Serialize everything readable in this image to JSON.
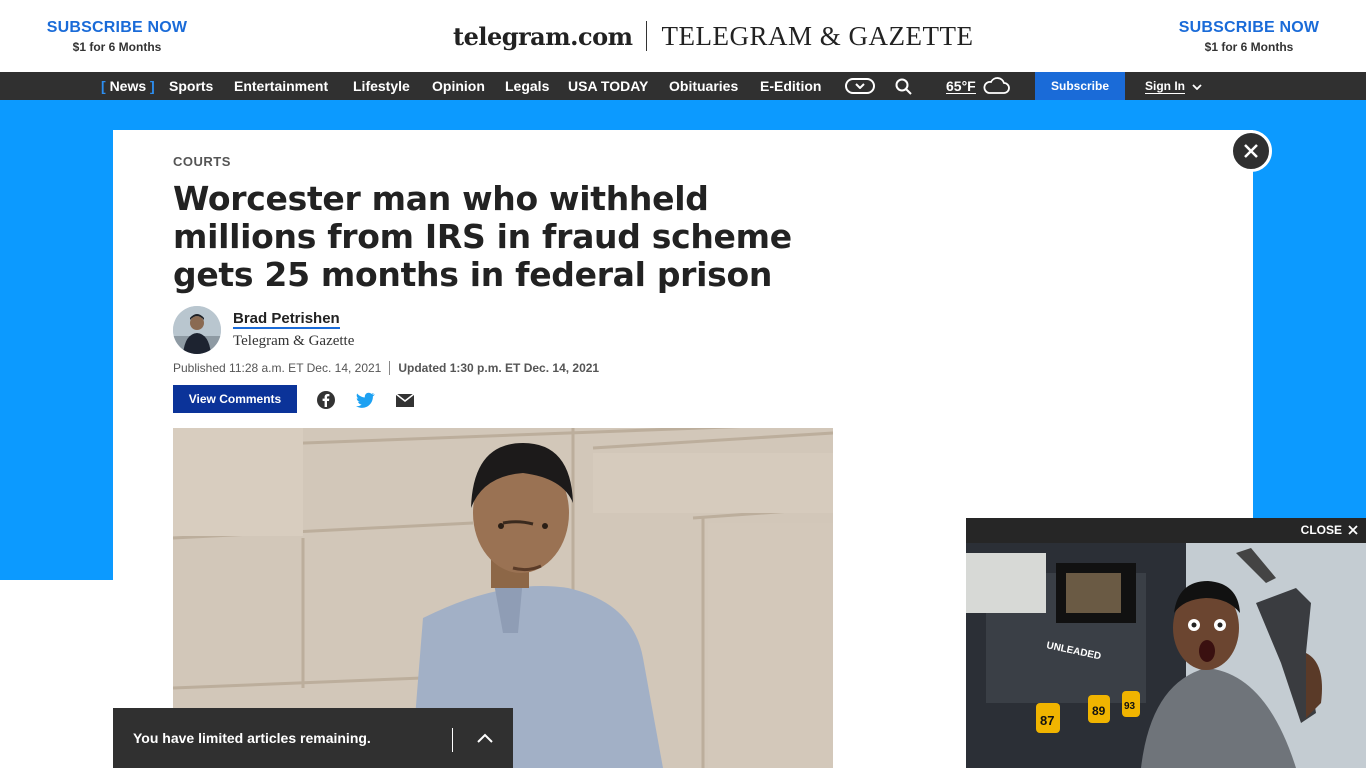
{
  "header": {
    "promo_left": {
      "title": "SUBSCRIBE NOW",
      "subtitle": "$1 for 6 Months"
    },
    "promo_right": {
      "title": "SUBSCRIBE NOW",
      "subtitle": "$1 for 6 Months"
    },
    "site_name": "telegram.com",
    "brand_name": "TELEGRAM & GAZETTE"
  },
  "nav": {
    "items": [
      "News",
      "Sports",
      "Entertainment",
      "Lifestyle",
      "Opinion",
      "Legals",
      "USA TODAY",
      "Obituaries",
      "E-Edition"
    ],
    "active": "News",
    "temperature": "65°F",
    "subscribe_label": "Subscribe",
    "signin_label": "Sign In"
  },
  "article": {
    "kicker": "COURTS",
    "headline": "Worcester man who withheld millions from IRS in fraud scheme gets 25 months in federal prison",
    "author_name": "Brad Petrishen",
    "author_publication": "Telegram & Gazette",
    "published": "Published 11:28 a.m. ET Dec. 14, 2021",
    "updated": "Updated 1:30 p.m. ET Dec. 14, 2021",
    "view_comments_label": "View Comments"
  },
  "limit_bar": {
    "text": "You have limited articles remaining."
  },
  "video": {
    "close_label": "CLOSE",
    "pump_text": "UNLEADED",
    "price_labels": [
      "87",
      "89",
      "93"
    ]
  },
  "colors": {
    "accent_blue": "#1a6bd8",
    "backdrop_blue": "#0c9aff",
    "nav_dark": "#303030",
    "comments_button": "#0b3399"
  }
}
